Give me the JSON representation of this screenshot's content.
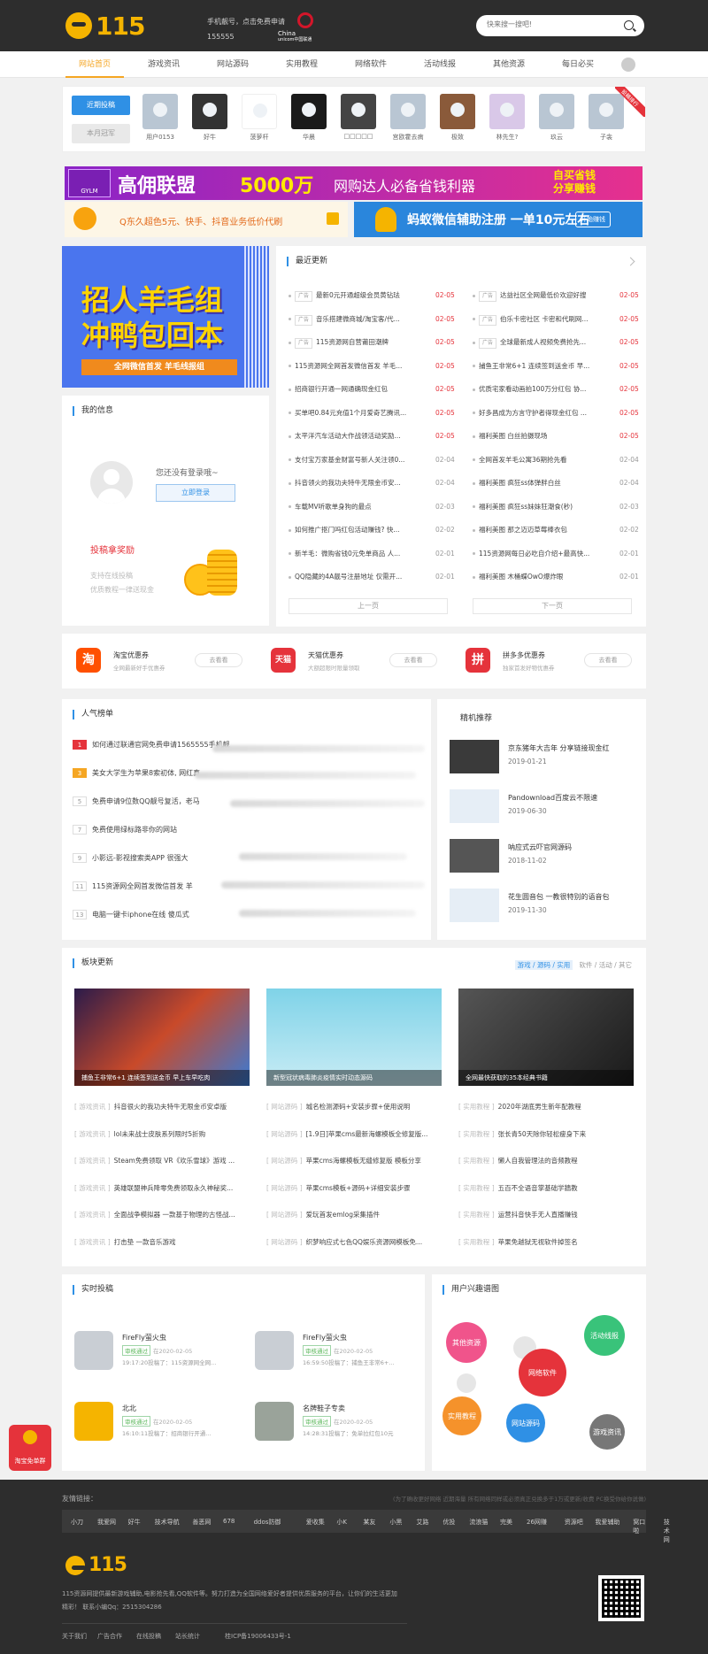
{
  "header": {
    "logo": "115",
    "promo_line1": "手机靓号，点击免费申请",
    "promo_line2": "155555",
    "unicom_cn": "China",
    "unicom_en": "unicom中国联通",
    "search_placeholder": "快来搜一搜吧!"
  },
  "nav": [
    "网站首页",
    "游戏资讯",
    "网站源码",
    "实用教程",
    "网络软件",
    "活动线报",
    "其他资源",
    "每日必买"
  ],
  "hot_users": {
    "tab_active": "近期投稿",
    "tab_other": "本月冠军",
    "ribbon": "投稿排行",
    "users": [
      "用户0153",
      "好牛",
      "菠萝杆",
      "华晨",
      "□□□□□",
      "宫欧霍去病",
      "极致",
      "林先生?",
      "玖云",
      "子衾"
    ]
  },
  "ads": {
    "ad1_badge": "GYLM",
    "ad1_t1": "高佣联盟",
    "ad1_t2": "5000万",
    "ad1_t3": "网购达人必备省钱利器",
    "ad1_t4a": "自买省钱",
    "ad1_t4b": "分享赚钱",
    "ad2_text": "Q东久超色5元、快手、抖音业务低价代刷",
    "ad3_text": "蚂蚁微信辅助注册 一单10元左右",
    "ad3_btn": "开始赚钱"
  },
  "recruit": {
    "line1": "招人羊毛组",
    "line2": "冲鸭包回本",
    "bar": "全网微信首发 羊毛线报组"
  },
  "myinfo": {
    "title": "我的信息",
    "not_logged": "您还没有登录哦~",
    "login_btn": "立即登录",
    "reward": "投稿拿奖励",
    "line1": "支持在线投稿",
    "line2": "优质教程一律送现金"
  },
  "recent": {
    "title": "最近更新",
    "prev": "上一页",
    "next": "下一页",
    "left": [
      {
        "tag": "广告",
        "t": "最新0元开通超级会员黄钻珐",
        "d": "02-05",
        "red": true
      },
      {
        "tag": "广告",
        "t": "音乐搭建微商城/淘宝客/代...",
        "d": "02-05",
        "red": true
      },
      {
        "tag": "广告",
        "t": "115资源网自营莆田潮牌",
        "d": "02-05",
        "red": true
      },
      {
        "tag": "",
        "t": "115资源网全网首发微信首发 羊毛...",
        "d": "02-05",
        "red": true
      },
      {
        "tag": "",
        "t": "招商银行开通一网通确现金红包",
        "d": "02-05",
        "red": true
      },
      {
        "tag": "",
        "t": "买单吧0.84元充值1个月爱奇艺腾讯...",
        "d": "02-05",
        "red": true
      },
      {
        "tag": "",
        "t": "太平洋汽车活动大作战领活动奖励...",
        "d": "02-05",
        "red": true
      },
      {
        "tag": "",
        "t": "支付宝万家基金财富号新人关注领0...",
        "d": "02-04",
        "red": false
      },
      {
        "tag": "",
        "t": "抖音领火的我功夫特牛无限金币安...",
        "d": "02-04",
        "red": false
      },
      {
        "tag": "",
        "t": "车载MV听歌单身狗的最点",
        "d": "02-03",
        "red": false
      },
      {
        "tag": "",
        "t": "如何推广抠门吗红包活动赚钱? 快...",
        "d": "02-02",
        "red": false
      },
      {
        "tag": "",
        "t": "新羊毛：微购省钱0元免单商品 人...",
        "d": "02-01",
        "red": false
      },
      {
        "tag": "",
        "t": "QQ隐藏的4A靓号注册地址 仅需开...",
        "d": "02-01",
        "red": false
      }
    ],
    "right": [
      {
        "tag": "广告",
        "t": "达益社区全网最低价欢迎好搜",
        "d": "02-05",
        "red": true
      },
      {
        "tag": "广告",
        "t": "伯乐卡密社区 卡密和代刷网...",
        "d": "02-05",
        "red": true
      },
      {
        "tag": "广告",
        "t": "全球最新成人视频免费抢先...",
        "d": "02-05",
        "red": true
      },
      {
        "tag": "",
        "t": "捕鱼王非常6+1 连续签到送金币 早...",
        "d": "02-05",
        "red": true
      },
      {
        "tag": "",
        "t": "优质宅家看动画拍100万分红包 协...",
        "d": "02-05",
        "red": true
      },
      {
        "tag": "",
        "t": "好多昌成为方言守护者得现金红包 ...",
        "d": "02-05",
        "red": true
      },
      {
        "tag": "",
        "t": "福利美图 白丝拍摄现场",
        "d": "02-05",
        "red": true
      },
      {
        "tag": "",
        "t": "全网首发羊毛公寓36期抢先看",
        "d": "02-04",
        "red": false
      },
      {
        "tag": "",
        "t": "福利美图 疯狂ss体弹胖白丝",
        "d": "02-04",
        "red": false
      },
      {
        "tag": "",
        "t": "福利美图 疯狂ss妹妹狂潮食(秒)",
        "d": "02-03",
        "red": false
      },
      {
        "tag": "",
        "t": "福利美图 那之迈迈草莓棒衣包",
        "d": "02-02",
        "red": false
      },
      {
        "tag": "",
        "t": "115资源网每日必吃自介绍+最高快...",
        "d": "02-01",
        "red": false
      },
      {
        "tag": "",
        "t": "福利美图 木桶蝶OwO爆炸眼",
        "d": "02-01",
        "red": false
      }
    ]
  },
  "coupons": [
    {
      "icon": "淘",
      "title": "淘宝优惠券",
      "sub": "全网最新好手优惠券",
      "btn": "去看看",
      "color": "#ff5000"
    },
    {
      "icon": "天猫",
      "title": "天猫优惠券",
      "sub": "大额超限时限量领取",
      "btn": "去看看",
      "color": "#e5333b"
    },
    {
      "icon": "拼",
      "title": "拼多多优惠券",
      "sub": "独家首发好物优惠券",
      "btn": "去看看",
      "color": "#e5333b"
    }
  ],
  "popular": {
    "title": "人气榜单",
    "items": [
      {
        "n": "1",
        "t": "如何通过联通官网免费申请1565555手机靓"
      },
      {
        "n": "3",
        "t": "美女大学生为苹果8索初体, 网红真"
      },
      {
        "n": "5",
        "t": "免费申请9位数QQ靓号复活，老马"
      },
      {
        "n": "7",
        "t": "免费使用绿标路非你的网站"
      },
      {
        "n": "9",
        "t": "小影远-影视搜索类APP 很强大"
      },
      {
        "n": "11",
        "t": "115资源网全网首发微信首发 羊"
      },
      {
        "n": "13",
        "t": "电脑一键卡iphone在线 傻瓜式"
      }
    ]
  },
  "tech": {
    "title": "精机推荐",
    "items": [
      {
        "t": "京东猪年大吉年 分享链接现金红",
        "d": "2019-01-21"
      },
      {
        "t": "Pandownload百度云不限速",
        "d": "2019-06-30"
      },
      {
        "t": "呐应式云吓官网源码",
        "d": "2018-11-02"
      },
      {
        "t": "花生圆音包 一教很特别的语音包",
        "d": "2019-11-30"
      }
    ]
  },
  "board": {
    "title": "板块更新",
    "tabs_on": "游戏 / 源码 / 实用",
    "tabs_off": "软件 / 活动 / 其它",
    "images": [
      "捕鱼王非常6+1 连续签到送金币 早上车早吃肉",
      "新型冠状病毒肺炎疫情实时动态源码",
      "全网最快获取的35本经典书籍"
    ],
    "cols": [
      [
        [
          "游戏资讯",
          "抖音很火的我功夫特牛无限金币安卓版"
        ],
        [
          "游戏资讯",
          "lol未来战士皮肤系列限时5折购"
        ],
        [
          "游戏资讯",
          "Steam免费领取 VR《欢乐雪球》游戏 ..."
        ],
        [
          "游戏资讯",
          "英雄联盟神兵降零免费领取永久神秘奖..."
        ],
        [
          "游戏资讯",
          "全面战争模拟器 一款基于物理的古怪战..."
        ],
        [
          "游戏资讯",
          "打击垫 一款音乐游戏"
        ]
      ],
      [
        [
          "网站源码",
          "城名检测源码+安装步骤+使用说明"
        ],
        [
          "网站源码",
          "[1.9日]苹果cms最新海螺模板全修复版..."
        ],
        [
          "网站源码",
          "苹果cms海螺模板无缝修复版 模板分享"
        ],
        [
          "网站源码",
          "苹果cms模板+源码+详细安装步骤"
        ],
        [
          "网站源码",
          "爱玩首发emlog采集插件"
        ],
        [
          "网站源码",
          "织梦响应式七色QQ娱乐资源网模板免..."
        ]
      ],
      [
        [
          "实用教程",
          "2020年湖底男生新年配教程"
        ],
        [
          "实用教程",
          "张长青50天除你轻松瘦身下来"
        ],
        [
          "实用教程",
          "懒人自我管理法的音频教程"
        ],
        [
          "实用教程",
          "五百不全语音掌基础学牆教"
        ],
        [
          "实用教程",
          "运营抖音快手无人直播赚钱"
        ],
        [
          "实用教程",
          "苹果免越狱无视软件掉签名"
        ]
      ]
    ]
  },
  "contrib": {
    "title": "实时投稿",
    "items": [
      {
        "name": "FireFly萤火虫",
        "aud": "审核通过",
        "meta": "在2020-02-05",
        "msg": "19:17:20投稿了：115资源网全网..."
      },
      {
        "name": "FireFly萤火虫",
        "aud": "审核通过",
        "meta": "在2020-02-05",
        "msg": "16:59:50投稿了：捕鱼王非常6+..."
      },
      {
        "name": "北北",
        "aud": "审核通过",
        "meta": "在2020-02-05",
        "msg": "16:10:11投稿了：招商银行开通..."
      },
      {
        "name": "名牌鞋子专卖",
        "aud": "审核通过",
        "meta": "在2020-02-05",
        "msg": "14:28:31投稿了：免单拉红包10元"
      }
    ]
  },
  "interest": {
    "title": "用户兴趣谱图",
    "bubbles": [
      "其他资源",
      "活动线报",
      "网络软件",
      "实用教程",
      "网站源码",
      "游戏资讯"
    ]
  },
  "footer": {
    "links_title": "友情链接：",
    "note": "(为了确收更好网络 近期海量 所有网络同样或必须真正兑换多于1万或更新/收费 PC换受你给你说做)",
    "links": [
      "小刀",
      "我爱网",
      "好牛",
      "技术导航",
      "善恶网",
      "678",
      "ddos防御",
      "爱收集",
      "小K",
      "某友",
      "小黑",
      "艾路",
      "优投",
      "流浪猫",
      "完美",
      "26网赚",
      "资源吧",
      "我爱辅助",
      "窝口啦",
      "技术网"
    ],
    "logo": "115",
    "desc": "115资源网提供最新游戏辅助,电影抢先看,QQ软件等。努力打造为全国网络爱好者提供优质服务的平台，让你们的生活更加精彩！ 联系小编Qq：2515304286",
    "bottom": [
      "关于我们",
      "广告合作",
      "在线投稿",
      "站长统计",
      "桂ICP备19006433号-1"
    ]
  },
  "floating": {
    "red_packet": "淘宝免单群"
  },
  "colors": {
    "accent": "#f5a623",
    "blue": "#2f90e5",
    "red": "#e5333b",
    "dark": "#2d2d2d"
  }
}
